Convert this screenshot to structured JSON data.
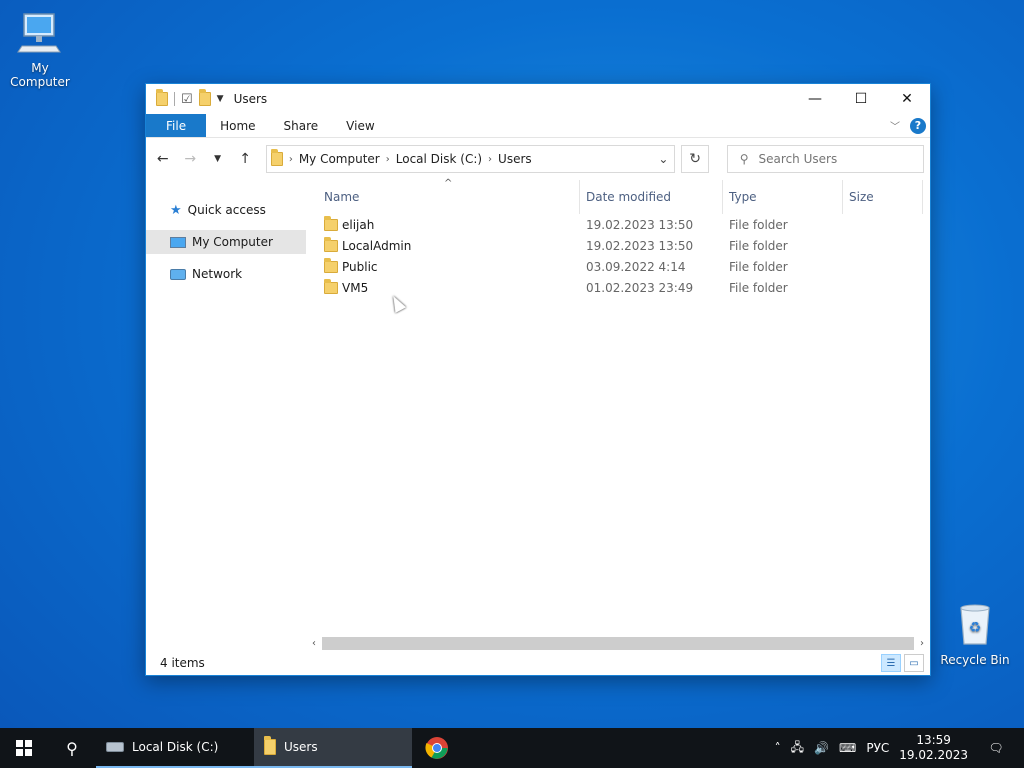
{
  "desktop": {
    "my_computer_label": "My Computer",
    "recycle_bin_label": "Recycle Bin"
  },
  "window": {
    "title": "Users",
    "controls": {
      "minimize": "—",
      "maximize": "☐",
      "close": "✕"
    }
  },
  "ribbon": {
    "tabs": [
      "File",
      "Home",
      "Share",
      "View"
    ],
    "help": "?"
  },
  "address": {
    "crumbs": [
      "My Computer",
      "Local Disk (C:)",
      "Users"
    ]
  },
  "search": {
    "placeholder": "Search Users"
  },
  "navpane": {
    "items": [
      {
        "label": "Quick access",
        "icon": "star-icon",
        "selected": false
      },
      {
        "label": "My Computer",
        "icon": "computer-icon",
        "selected": true
      },
      {
        "label": "Network",
        "icon": "network-icon",
        "selected": false
      }
    ]
  },
  "columns": {
    "name": "Name",
    "date": "Date modified",
    "type": "Type",
    "size": "Size"
  },
  "files": [
    {
      "name": "elijah",
      "date": "19.02.2023 13:50",
      "type": "File folder"
    },
    {
      "name": "LocalAdmin",
      "date": "19.02.2023 13:50",
      "type": "File folder"
    },
    {
      "name": "Public",
      "date": "03.09.2022 4:14",
      "type": "File folder"
    },
    {
      "name": "VM5",
      "date": "01.02.2023 23:49",
      "type": "File folder"
    }
  ],
  "status": {
    "item_count": "4 items"
  },
  "taskbar": {
    "apps": [
      {
        "label": "Local Disk (C:)",
        "icon": "drive-icon"
      },
      {
        "label": "Users",
        "icon": "folder-icon"
      }
    ],
    "tray": {
      "language": "РУС",
      "time": "13:59",
      "date": "19.02.2023"
    }
  },
  "colors": {
    "accent": "#1979ca",
    "selection": "#e5e5e5",
    "taskbar": "#101418"
  }
}
